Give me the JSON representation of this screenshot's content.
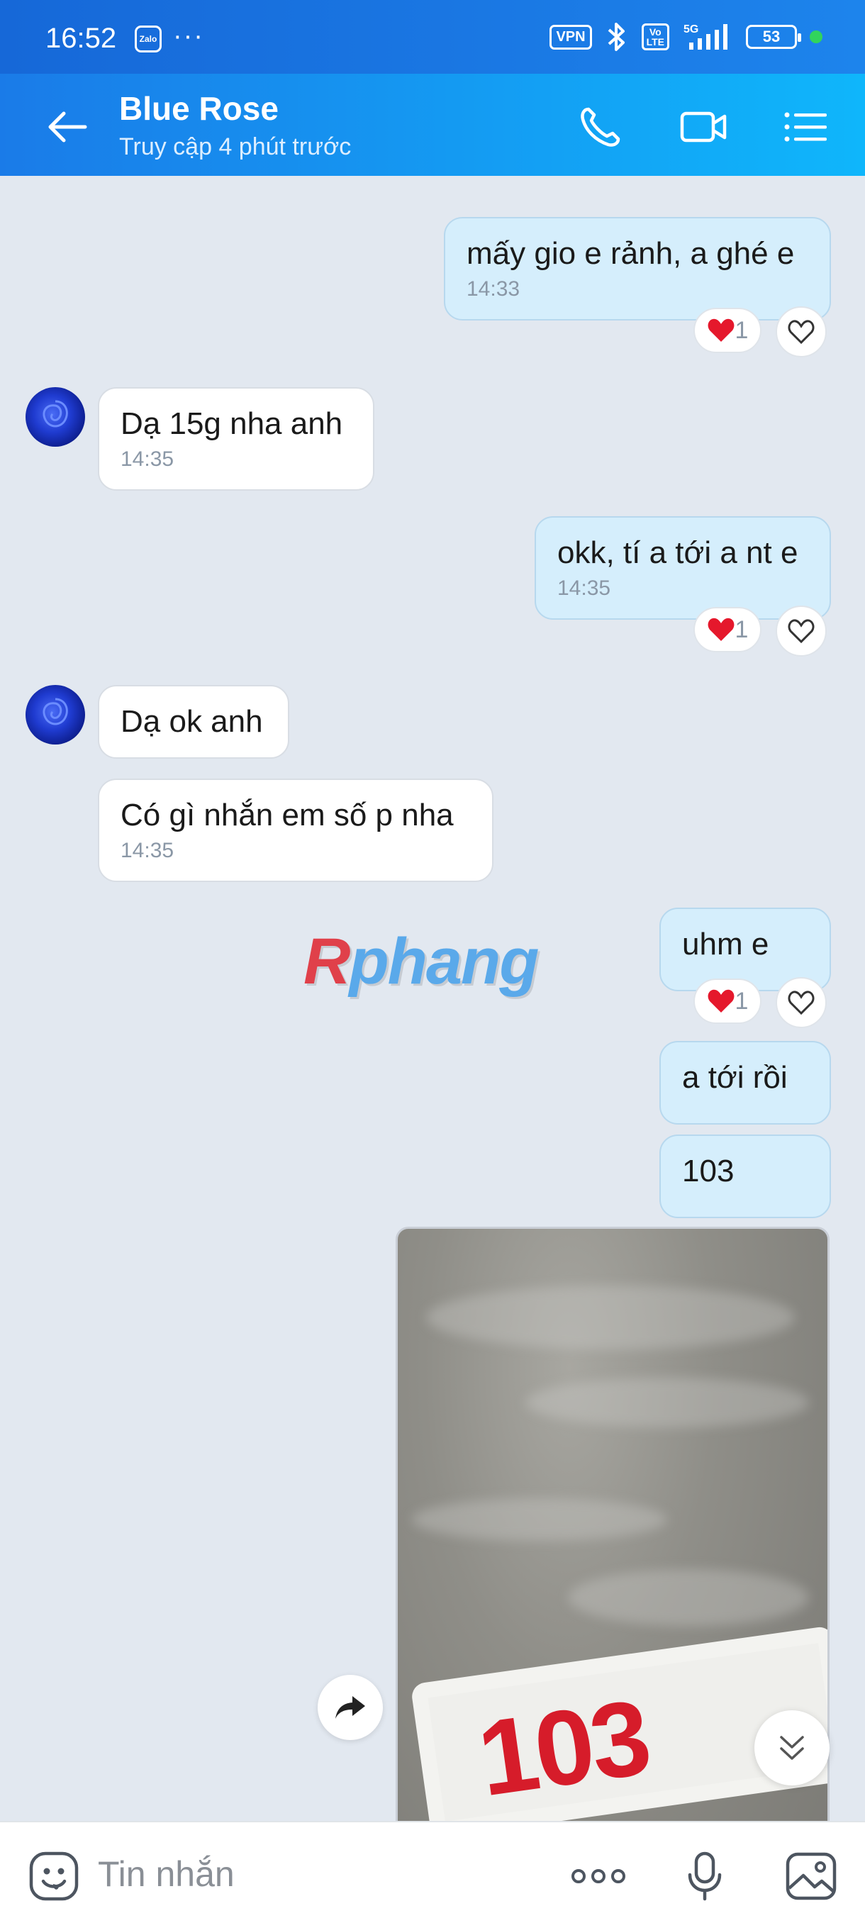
{
  "status_bar": {
    "time": "16:52",
    "app_badge": "Zalo",
    "dots": "···",
    "vpn": "VPN",
    "volte": "Vo\nLTE",
    "network": "5G",
    "battery": "53"
  },
  "header": {
    "contact_name": "Blue Rose",
    "last_seen": "Truy cập 4 phút trước"
  },
  "messages": [
    {
      "dir": "out",
      "text": "mấy gio e rảnh, a ghé e",
      "time": "14:33",
      "reaction_count": "1"
    },
    {
      "dir": "in",
      "text": "Dạ 15g nha anh",
      "time": "14:35"
    },
    {
      "dir": "out",
      "text": "okk, tí a tới a nt e",
      "time": "14:35",
      "reaction_count": "1"
    },
    {
      "dir": "in",
      "text": "Dạ ok anh"
    },
    {
      "dir": "in",
      "text": "Có gì nhắn em số p nha",
      "time": "14:35"
    },
    {
      "dir": "out",
      "text": "uhm e",
      "reaction_count": "1"
    },
    {
      "dir": "out",
      "text": "a tới rồi"
    },
    {
      "dir": "out",
      "text": "103"
    }
  ],
  "photo": {
    "sign_text": "103"
  },
  "watermark": {
    "first": "R",
    "rest": "phang"
  },
  "input": {
    "placeholder": "Tin nhắn"
  },
  "colors": {
    "accent": "#1a7be8",
    "outgoing_bubble": "#d5eefc",
    "incoming_bubble": "#ffffff",
    "background": "#e2e8f0"
  }
}
